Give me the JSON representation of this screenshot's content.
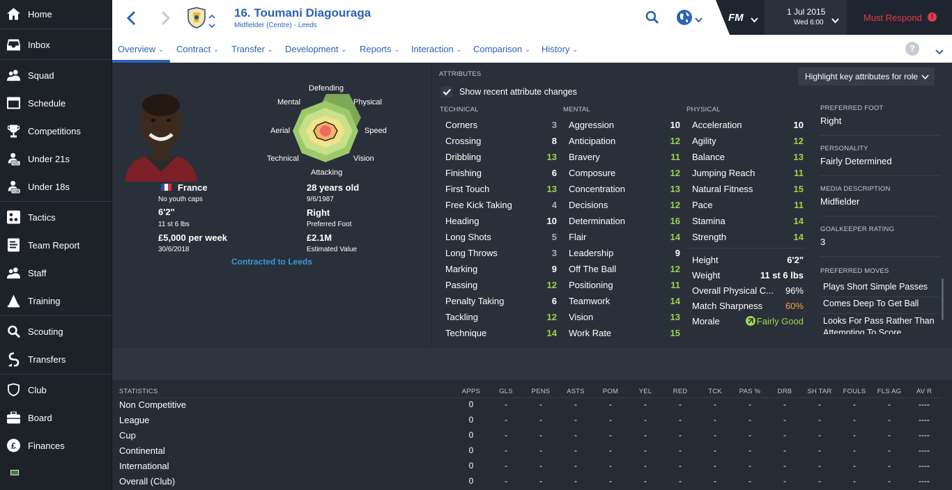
{
  "sidebar": {
    "items": [
      {
        "label": "Home",
        "icon": "home-icon"
      },
      {
        "label": "Inbox",
        "icon": "inbox-icon"
      },
      {
        "label": "Squad",
        "icon": "squad-icon"
      },
      {
        "label": "Schedule",
        "icon": "calendar-icon"
      },
      {
        "label": "Competitions",
        "icon": "trophy-icon"
      },
      {
        "label": "Under 21s",
        "icon": "under21-icon"
      },
      {
        "label": "Under 18s",
        "icon": "under18-icon"
      },
      {
        "label": "Tactics",
        "icon": "tactics-icon"
      },
      {
        "label": "Team Report",
        "icon": "report-icon"
      },
      {
        "label": "Staff",
        "icon": "staff-icon"
      },
      {
        "label": "Training",
        "icon": "training-icon"
      },
      {
        "label": "Scouting",
        "icon": "scouting-icon"
      },
      {
        "label": "Transfers",
        "icon": "transfers-icon"
      },
      {
        "label": "Club",
        "icon": "club-icon"
      },
      {
        "label": "Board",
        "icon": "board-icon"
      },
      {
        "label": "Finances",
        "icon": "finances-icon"
      }
    ],
    "icon_badges": {
      "under21": "U21",
      "under18": "U18",
      "finances": "£"
    }
  },
  "header": {
    "player_title": "16. Toumani Diagouraga",
    "player_subtitle": "Midfielder (Centre) - Leeds",
    "fm_label": "FM",
    "date": "1 Jul 2015",
    "time": "Wed 6:00",
    "must_respond": "Must Respond",
    "alert_mark": "!",
    "help_mark": "?"
  },
  "tabs": [
    "Overview",
    "Contract",
    "Transfer",
    "Development",
    "Reports",
    "Interaction",
    "Comparison",
    "History"
  ],
  "profile": {
    "nationality": "France",
    "youth_caps": "No youth caps",
    "height": "6'2\"",
    "weight": "11 st 6 lbs",
    "wage": "£5,000 per week",
    "contract_end": "30/6/2018",
    "age": "28 years old",
    "dob": "9/6/1987",
    "foot": "Right",
    "foot_label": "Preferred Foot",
    "value": "£2.1M",
    "value_label": "Estimated Value",
    "contract_link": "Contracted to Leeds"
  },
  "radar": {
    "labels": {
      "defending": "Defending",
      "physical": "Physical",
      "speed": "Speed",
      "vision": "Vision",
      "attacking": "Attacking",
      "technical": "Technical",
      "aerial": "Aerial",
      "mental": "Mental"
    }
  },
  "attributes": {
    "title": "ATTRIBUTES",
    "highlight_dropdown": "Highlight key attributes for role",
    "show_changes": "Show recent attribute changes",
    "technical_header": "TECHNICAL",
    "mental_header": "MENTAL",
    "physical_header": "PHYSICAL",
    "technical": [
      {
        "name": "Corners",
        "value": "3"
      },
      {
        "name": "Crossing",
        "value": "8"
      },
      {
        "name": "Dribbling",
        "value": "13"
      },
      {
        "name": "Finishing",
        "value": "6"
      },
      {
        "name": "First Touch",
        "value": "13"
      },
      {
        "name": "Free Kick Taking",
        "value": "4"
      },
      {
        "name": "Heading",
        "value": "10"
      },
      {
        "name": "Long Shots",
        "value": "5"
      },
      {
        "name": "Long Throws",
        "value": "3"
      },
      {
        "name": "Marking",
        "value": "9"
      },
      {
        "name": "Passing",
        "value": "12"
      },
      {
        "name": "Penalty Taking",
        "value": "6"
      },
      {
        "name": "Tackling",
        "value": "12"
      },
      {
        "name": "Technique",
        "value": "14"
      }
    ],
    "mental": [
      {
        "name": "Aggression",
        "value": "10"
      },
      {
        "name": "Anticipation",
        "value": "12"
      },
      {
        "name": "Bravery",
        "value": "11"
      },
      {
        "name": "Composure",
        "value": "12"
      },
      {
        "name": "Concentration",
        "value": "13"
      },
      {
        "name": "Decisions",
        "value": "12"
      },
      {
        "name": "Determination",
        "value": "16"
      },
      {
        "name": "Flair",
        "value": "14"
      },
      {
        "name": "Leadership",
        "value": "9"
      },
      {
        "name": "Off The Ball",
        "value": "12"
      },
      {
        "name": "Positioning",
        "value": "11"
      },
      {
        "name": "Teamwork",
        "value": "14"
      },
      {
        "name": "Vision",
        "value": "13"
      },
      {
        "name": "Work Rate",
        "value": "15"
      }
    ],
    "physical": [
      {
        "name": "Acceleration",
        "value": "10"
      },
      {
        "name": "Agility",
        "value": "12"
      },
      {
        "name": "Balance",
        "value": "13"
      },
      {
        "name": "Jumping Reach",
        "value": "11"
      },
      {
        "name": "Natural Fitness",
        "value": "15"
      },
      {
        "name": "Pace",
        "value": "11"
      },
      {
        "name": "Stamina",
        "value": "14"
      },
      {
        "name": "Strength",
        "value": "14"
      }
    ],
    "physical_extra": [
      {
        "name": "Height",
        "value": "6'2\""
      },
      {
        "name": "Weight",
        "value": "11 st 6 lbs"
      },
      {
        "name": "Overall Physical C...",
        "value": "96%"
      },
      {
        "name": "Match Sharpness",
        "value": "60%"
      },
      {
        "name": "Morale",
        "value": "Fairly Good"
      }
    ]
  },
  "info": {
    "preferred_foot_label": "PREFERRED FOOT",
    "preferred_foot": "Right",
    "personality_label": "PERSONALITY",
    "personality": "Fairly Determined",
    "media_label": "MEDIA DESCRIPTION",
    "media": "Midfielder",
    "gk_label": "GOALKEEPER RATING",
    "gk": "3",
    "moves_label": "PREFERRED MOVES",
    "moves": [
      "Plays Short Simple Passes",
      "Comes Deep To Get Ball",
      "Looks For Pass Rather Than Attempting To Score"
    ]
  },
  "statistics": {
    "title": "STATISTICS",
    "columns": [
      "APPS",
      "GLS",
      "PENS",
      "ASTS",
      "POM",
      "YEL",
      "RED",
      "TCK",
      "PAS %",
      "DRB",
      "SH TAR",
      "FOULS",
      "FLS AG",
      "AV R"
    ],
    "rows": [
      {
        "label": "Non Competitive",
        "apps": "0",
        "dash": "-",
        "avr": "----"
      },
      {
        "label": "League",
        "apps": "0",
        "dash": "-",
        "avr": "----"
      },
      {
        "label": "Cup",
        "apps": "0",
        "dash": "-",
        "avr": "----"
      },
      {
        "label": "Continental",
        "apps": "0",
        "dash": "-",
        "avr": "----"
      },
      {
        "label": "International",
        "apps": "0",
        "dash": "-",
        "avr": "----"
      },
      {
        "label": "Overall (Club)",
        "apps": "0",
        "dash": "-",
        "avr": "----"
      }
    ]
  },
  "colors": {
    "accent": "#2a63b8",
    "must_respond": "#e43b45",
    "attr_green": "#9ed24b",
    "attr_dim": "#a8adb6",
    "orange": "#f0a13c",
    "morale_green": "#a4d44e"
  }
}
